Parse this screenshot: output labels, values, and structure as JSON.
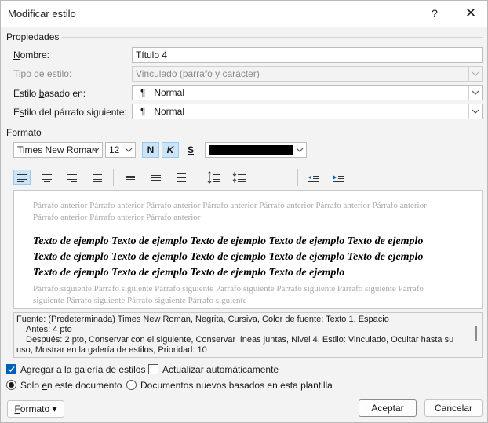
{
  "window": {
    "title": "Modificar estilo",
    "help_glyph": "?",
    "close_glyph": "✕"
  },
  "properties": {
    "section_label": "Propiedades",
    "name": {
      "label_pre": "",
      "label_u": "N",
      "label_post": "ombre:",
      "value": "Título 4"
    },
    "style_type": {
      "label": "Tipo de estilo:",
      "value": "Vinculado (párrafo y carácter)"
    },
    "based_on": {
      "label_pre": "Estilo ",
      "label_u": "b",
      "label_post": "asado en:",
      "value": "Normal"
    },
    "next_style": {
      "label_pre": "E",
      "label_u": "s",
      "label_post": "tilo del párrafo siguiente:",
      "value": "Normal"
    }
  },
  "format": {
    "section_label": "Formato",
    "font": "Times New Roman",
    "size": "12",
    "bold": "N",
    "italic": "K",
    "underline": "S",
    "font_color": "#000000"
  },
  "preview": {
    "prev_paragraph": "Párrafo anterior Párrafo anterior Párrafo anterior Párrafo anterior Párrafo anterior Párrafo anterior Párrafo anterior Párrafo anterior Párrafo anterior Párrafo anterior",
    "sample": "Texto de ejemplo Texto de ejemplo Texto de ejemplo Texto de ejemplo Texto de ejemplo Texto de ejemplo Texto de ejemplo Texto de ejemplo Texto de ejemplo Texto de ejemplo Texto de ejemplo Texto de ejemplo Texto de ejemplo Texto de ejemplo",
    "next_paragraph": "Párrafo siguiente Párrafo siguiente Párrafo siguiente Párrafo siguiente Párrafo siguiente Párrafo siguiente Párrafo siguiente Párrafo siguiente Párrafo siguiente Párrafo siguiente"
  },
  "description": {
    "line1": "Fuente: (Predeterminada) Times New Roman, Negrita, Cursiva, Color de fuente: Texto 1, Espacio",
    "line2": "Antes:  4 pto",
    "line3": "Después:  2 pto, Conservar con el siguiente, Conservar líneas juntas, Nivel 4, Estilo: Vinculado, Ocultar hasta su uso, Mostrar en la galería de estilos, Prioridad: 10"
  },
  "options": {
    "add_gallery": {
      "pre": "",
      "u": "A",
      "post": "gregar a la galería de estilos",
      "checked": true
    },
    "auto_update": {
      "pre": "",
      "u": "A",
      "post": "ctualizar automáticamente",
      "checked": false
    },
    "only_doc": {
      "pre": "Solo ",
      "u": "e",
      "post": "n este documento",
      "checked": true
    },
    "new_docs": {
      "label": "Documentos nuevos basados en esta plantilla",
      "checked": false
    }
  },
  "buttons": {
    "format_pre": "",
    "format_u": "F",
    "format_post": "ormato",
    "format_arrow": "▾",
    "ok": "Aceptar",
    "cancel": "Cancelar"
  },
  "colors": {
    "accent": "#005fb8",
    "active_bg": "#cce4f7"
  }
}
